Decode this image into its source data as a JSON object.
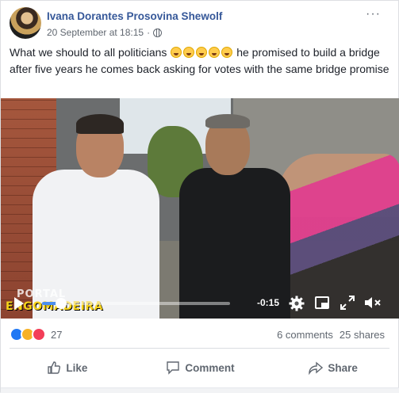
{
  "post": {
    "author": "Ivana Dorantes Prosovina Shewolf",
    "timestamp": "20 September at 18:15",
    "more_label": "···",
    "text": "What we should to all politicians",
    "text_after": "he promised to build a bridge after five years he comes back asking for votes with the same bridge promise",
    "emojis": [
      "rolling-laughing-emoji",
      "rolling-laughing-emoji",
      "grinning-sweat-emoji",
      "grinning-sweat-emoji",
      "smiling-emoji"
    ]
  },
  "video": {
    "watermark_top": "PORTAL",
    "watermark_bottom": "ENGOMADEIRA",
    "time_remaining": "-0:15",
    "progress": 0.1,
    "accent_color": "#4b8ff0"
  },
  "engagement": {
    "reaction_icons": [
      "like-reaction-icon",
      "haha-reaction-icon",
      "love-reaction-icon"
    ],
    "reaction_count": "27",
    "comments": "6 comments",
    "shares": "25 shares"
  },
  "actions": {
    "like": "Like",
    "comment": "Comment",
    "share": "Share"
  },
  "colors": {
    "author": "#365899",
    "secondary_text": "#606770"
  }
}
